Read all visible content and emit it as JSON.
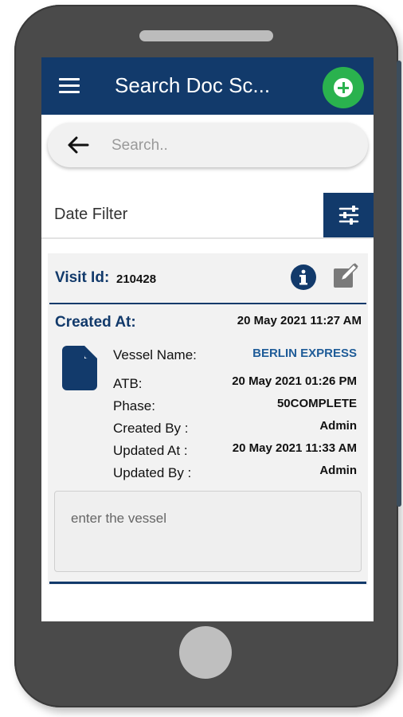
{
  "header": {
    "title": "Search Doc Sc..."
  },
  "search": {
    "placeholder": "Search.."
  },
  "filter": {
    "label": "Date Filter"
  },
  "card": {
    "visit_id_label": "Visit Id:",
    "visit_id_value": "210428",
    "created_at_label": "Created At:",
    "created_at_value": "20 May 2021 11:27 AM",
    "fields": [
      {
        "label": "Vessel Name:",
        "value": "BERLIN EXPRESS"
      },
      {
        "label": "ATB:",
        "value": "20 May 2021 01:26 PM"
      },
      {
        "label": "Phase:",
        "value": "50COMPLETE"
      },
      {
        "label": "Created By :",
        "value": "Admin"
      },
      {
        "label": "Updated At :",
        "value": "20 May 2021 11:33 AM"
      },
      {
        "label": "Updated By :",
        "value": "Admin"
      }
    ],
    "vessel_input_placeholder": "enter the vessel"
  },
  "icons": {
    "menu": "menu-icon",
    "add": "add-circle-icon",
    "back": "back-arrow-icon",
    "filter": "sliders-icon",
    "info": "info-icon",
    "edit": "edit-icon",
    "document": "document-icon"
  },
  "colors": {
    "primary": "#123a6b",
    "accent_green": "#2ab24e",
    "link_blue": "#1f5c98"
  }
}
